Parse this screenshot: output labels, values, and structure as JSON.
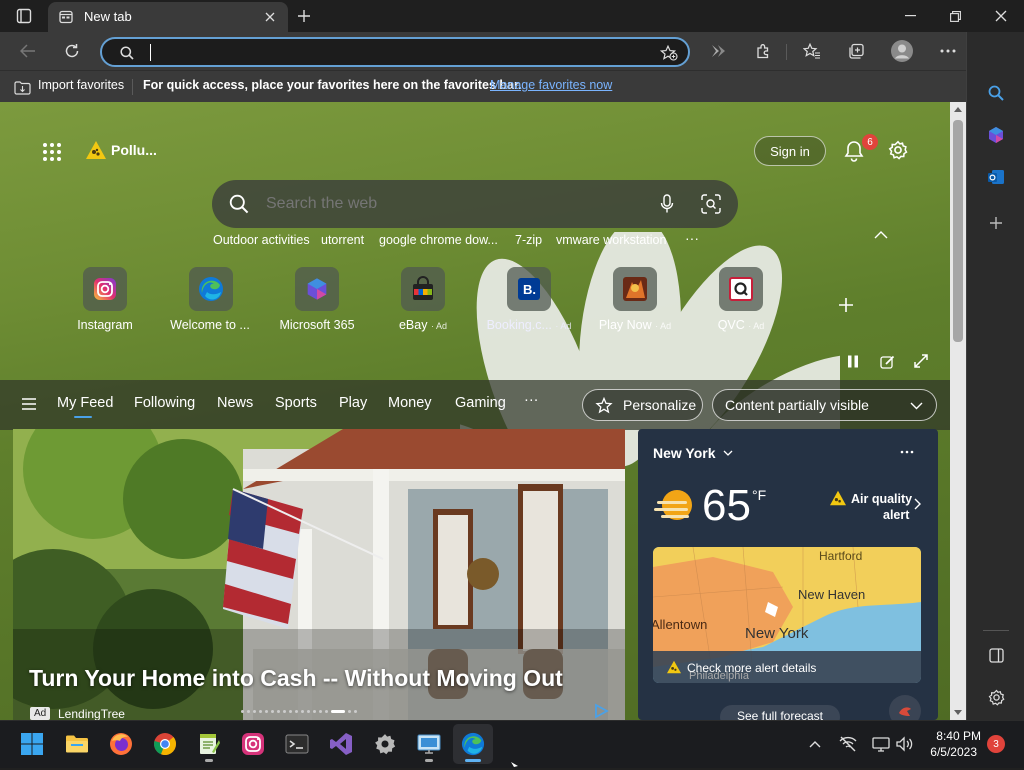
{
  "browser": {
    "tab_title": "New tab",
    "address_value": "",
    "favorites": {
      "import_label": "Import favorites",
      "hint": "For quick access, place your favorites here on the favorites bar.",
      "manage_link": "Manage favorites now"
    }
  },
  "header": {
    "pollen_label": "Pollu...",
    "sign_in": "Sign in",
    "notification_count": "6"
  },
  "search": {
    "placeholder": "Search the web",
    "trending": [
      "Outdoor activities",
      "utorrent",
      "google chrome dow...",
      "7-zip",
      "vmware workstation"
    ],
    "more": "···"
  },
  "quick_links": [
    {
      "label": "Instagram",
      "ad": ""
    },
    {
      "label": "Welcome to ...",
      "ad": ""
    },
    {
      "label": "Microsoft 365",
      "ad": ""
    },
    {
      "label": "eBay",
      "ad": "Ad"
    },
    {
      "label": "Booking.c...",
      "ad": "Ad"
    },
    {
      "label": "Play Now",
      "ad": "Ad"
    },
    {
      "label": "QVC",
      "ad": "Ad"
    }
  ],
  "feed": {
    "tabs": [
      "My Feed",
      "Following",
      "News",
      "Sports",
      "Play",
      "Money",
      "Gaming"
    ],
    "more": "···",
    "personalize": "Personalize",
    "visibility": "Content partially visible"
  },
  "hero": {
    "headline": "Turn Your Home into Cash -- Without Moving Out",
    "ad_badge": "Ad",
    "source": "LendingTree"
  },
  "weather": {
    "city": "New York",
    "temp": "65",
    "unit": "°F",
    "alert_line1": "Air quality",
    "alert_line2": "alert",
    "map_labels": [
      "Hartford",
      "New Haven",
      "Allentown",
      "New York",
      "Philadelphia"
    ],
    "alert_details": "Check more alert details",
    "forecast_link": "See full forecast"
  },
  "taskbar": {
    "time": "8:40 PM",
    "date": "6/5/2023",
    "notifications": "3"
  },
  "colors": {
    "accent": "#4aa1e8",
    "address_border": "#64a0d4",
    "notif_badge": "#e0433b"
  }
}
